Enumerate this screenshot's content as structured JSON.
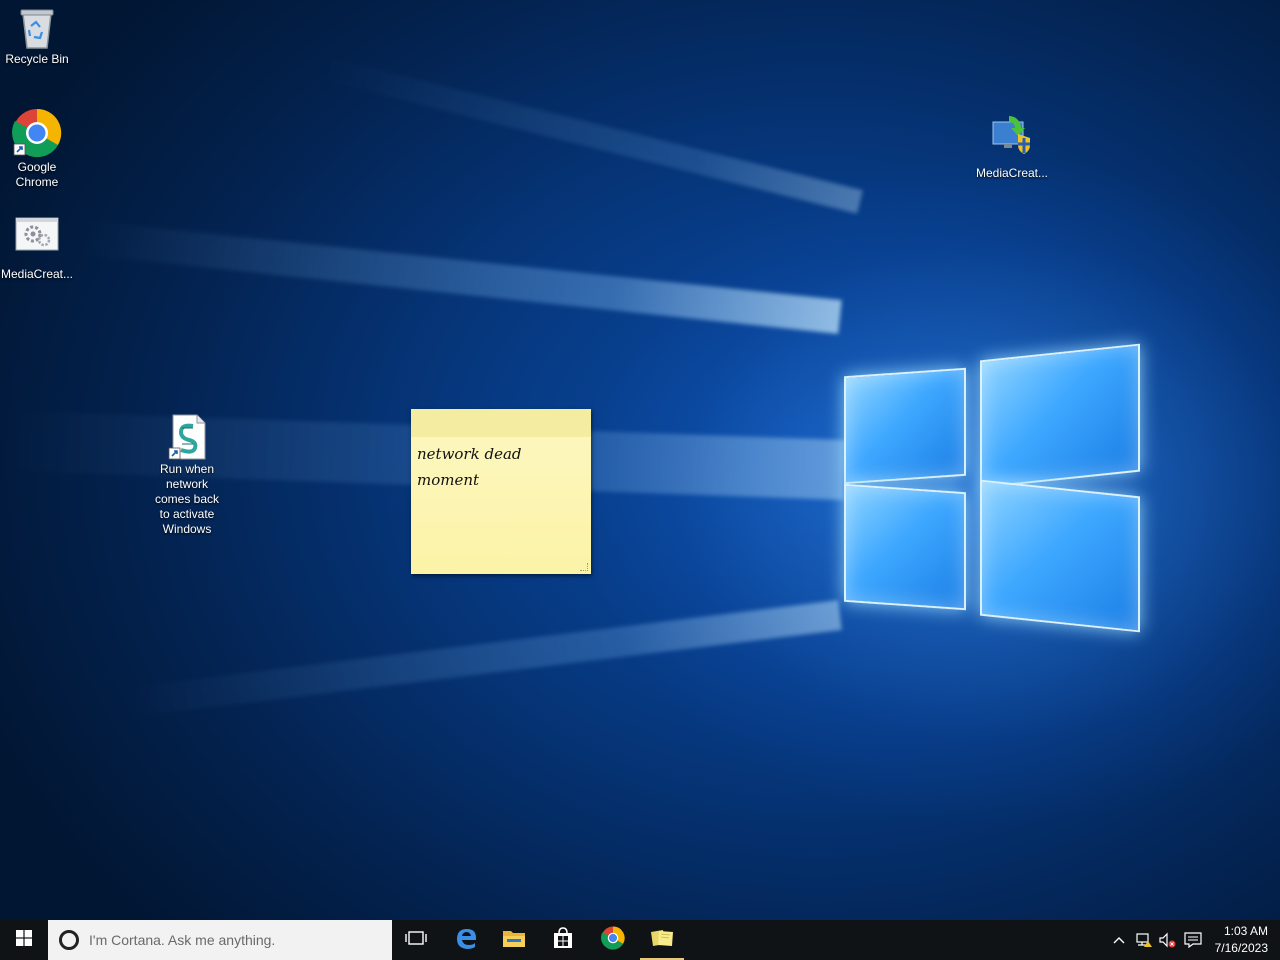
{
  "desktop": {
    "icons": [
      {
        "name": "recycle-bin",
        "label": "Recycle Bin",
        "icon": "recycle-bin-icon"
      },
      {
        "name": "google-chrome",
        "label": "Google Chrome",
        "icon": "chrome-icon"
      },
      {
        "name": "mediacreation-left",
        "label": "MediaCreat...",
        "icon": "gear-window-icon"
      },
      {
        "name": "mediacreation-right",
        "label": "MediaCreat...",
        "icon": "media-creation-tool-icon"
      },
      {
        "name": "run-script",
        "label": "Run when network comes back to activate Windows",
        "icon": "script-shortcut-icon"
      }
    ],
    "sticky_note": {
      "text_line1": "network dead",
      "text_line2": "moment"
    }
  },
  "taskbar": {
    "start": {
      "icon": "windows-start-icon"
    },
    "search": {
      "placeholder": "I'm Cortana. Ask me anything."
    },
    "pinned": [
      {
        "name": "task-view",
        "icon": "task-view-icon"
      },
      {
        "name": "edge",
        "icon": "edge-icon"
      },
      {
        "name": "file-explorer",
        "icon": "folder-icon"
      },
      {
        "name": "store",
        "icon": "store-icon"
      },
      {
        "name": "chrome",
        "icon": "chrome-icon"
      },
      {
        "name": "sticky-notes",
        "icon": "sticky-notes-icon",
        "active": true
      }
    ],
    "tray": {
      "icons": [
        "chevron-up-icon",
        "network-icon",
        "volume-muted-icon",
        "action-center-icon"
      ],
      "time": "1:03 AM",
      "date": "7/16/2023"
    }
  },
  "colors": {
    "taskbar": "#101316",
    "search_box": "#f2f2f2",
    "sticky": "#fbf3a6",
    "active_indicator": "#e8c87a"
  }
}
